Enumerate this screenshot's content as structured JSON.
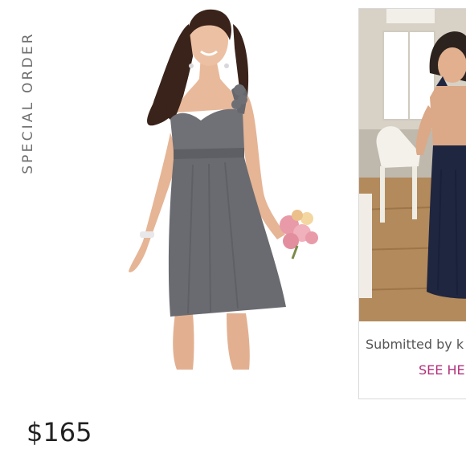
{
  "badge": {
    "text": "SPECIAL ORDER"
  },
  "photo_card": {
    "submitted_text": "Submitted by k",
    "link_text": "SEE HE"
  },
  "product": {
    "price": "$165"
  },
  "colors": {
    "dress": "#6a6b70",
    "navy_dress": "#222a44",
    "link": "#b0307a",
    "card_border": "#d9d9d9"
  },
  "icons": [
    "product-photo",
    "customer-photo"
  ]
}
